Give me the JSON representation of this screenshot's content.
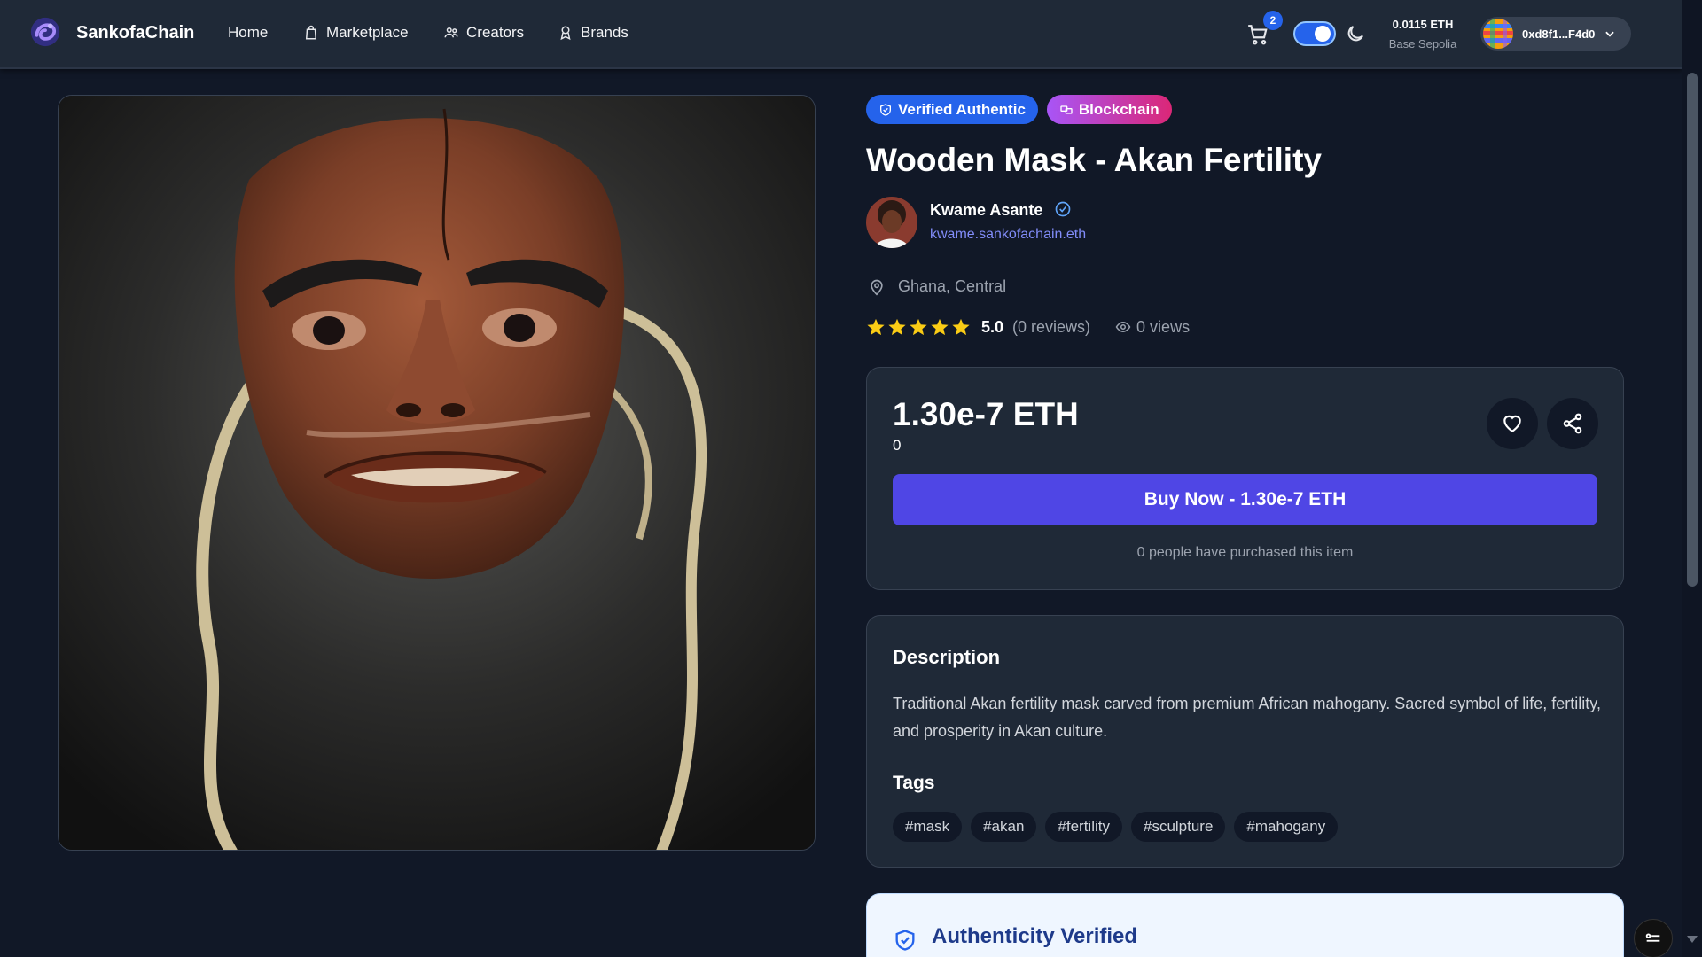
{
  "nav": {
    "brand": "SankofaChain",
    "links": [
      {
        "label": "Home",
        "icon": ""
      },
      {
        "label": "Marketplace",
        "icon": "shopping-bag-icon"
      },
      {
        "label": "Creators",
        "icon": "users-icon"
      },
      {
        "label": "Brands",
        "icon": "award-icon"
      }
    ],
    "cart_count": "2",
    "balance": "0.0115 ETH",
    "network": "Base Sepolia",
    "wallet_address": "0xd8f1...F4d0"
  },
  "product": {
    "badges": {
      "verified": "Verified Authentic",
      "chain": "Blockchain"
    },
    "title": "Wooden Mask - Akan Fertility",
    "creator": {
      "name": "Kwame Asante",
      "ens": "kwame.sankofachain.eth"
    },
    "location": "Ghana, Central",
    "rating": {
      "stars": 5,
      "value": "5.0",
      "reviews": "(0 reviews)"
    },
    "views": "0 views",
    "price": "1.30e-7 ETH",
    "price_fiat": "0",
    "buy_label": "Buy Now - 1.30e-7 ETH",
    "purchased_text": "0 people have purchased this item",
    "description_title": "Description",
    "description": "Traditional Akan fertility mask carved from premium African mahogany. Sacred symbol of life, fertility, and prosperity in Akan culture.",
    "tags_title": "Tags",
    "tags": [
      "#mask",
      "#akan",
      "#fertility",
      "#sculpture",
      "#mahogany"
    ],
    "authenticity_title": "Authenticity Verified"
  },
  "colors": {
    "background": "#111827",
    "card": "#1f2937",
    "accent": "#4f46e5",
    "verified_badge": "#2563eb",
    "star": "#facc15"
  }
}
